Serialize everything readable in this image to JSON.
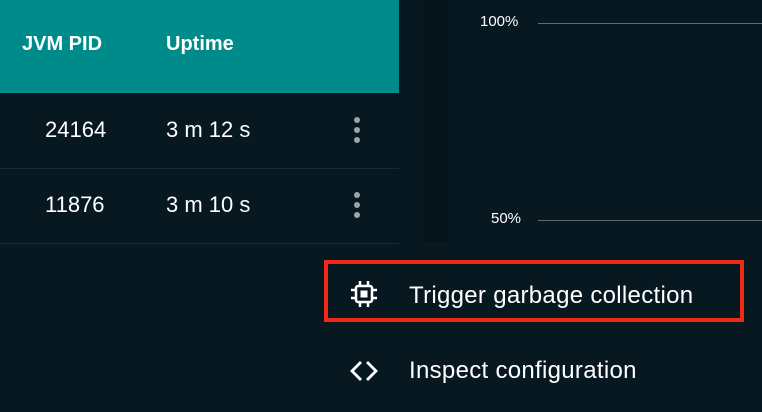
{
  "table": {
    "columns": {
      "pid": "JVM PID",
      "uptime": "Uptime"
    },
    "rows": [
      {
        "pid": "24164",
        "uptime": "3 m 12 s"
      },
      {
        "pid": "11876",
        "uptime": "3 m 10 s"
      }
    ]
  },
  "chart": {
    "y_tick_100": "100%",
    "y_tick_50": "50%"
  },
  "menu": {
    "items": [
      {
        "label": "Trigger garbage collection",
        "icon": "chip-icon",
        "highlighted": true
      },
      {
        "label": "Inspect configuration",
        "icon": "code-icon",
        "highlighted": false
      }
    ]
  },
  "colors": {
    "background": "#081820",
    "header": "#008b8b",
    "highlight_outline": "#f02a16",
    "kebab": "#9aa6ad"
  }
}
